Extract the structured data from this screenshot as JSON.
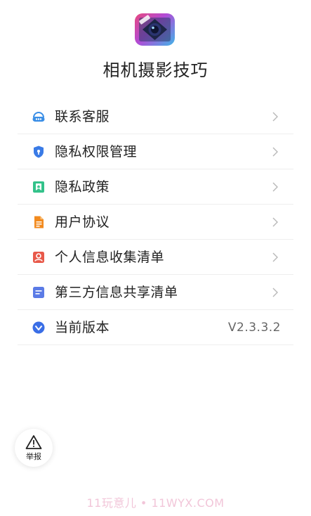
{
  "app": {
    "title": "相机摄影技巧",
    "icon": "camera-lens-app-icon"
  },
  "menu": {
    "items": [
      {
        "label": "联系客服",
        "icon": "customer-service-icon",
        "color": "#3a8ee6"
      },
      {
        "label": "隐私权限管理",
        "icon": "shield-icon",
        "color": "#3a7be6"
      },
      {
        "label": "隐私政策",
        "icon": "bookmark-icon",
        "color": "#33c28a"
      },
      {
        "label": "用户协议",
        "icon": "document-icon",
        "color": "#f28a1e"
      },
      {
        "label": "个人信息收集清单",
        "icon": "person-card-icon",
        "color": "#e8594a"
      },
      {
        "label": "第三方信息共享清单",
        "icon": "list-document-icon",
        "color": "#5b7be6"
      },
      {
        "label": "当前版本",
        "icon": "version-icon",
        "color": "#3a6ee6",
        "value": "V2.3.3.2"
      }
    ]
  },
  "report": {
    "label": "举报",
    "icon": "warning-triangle-icon"
  },
  "watermark": {
    "text": "11玩意儿 • 11WYX.COM"
  }
}
